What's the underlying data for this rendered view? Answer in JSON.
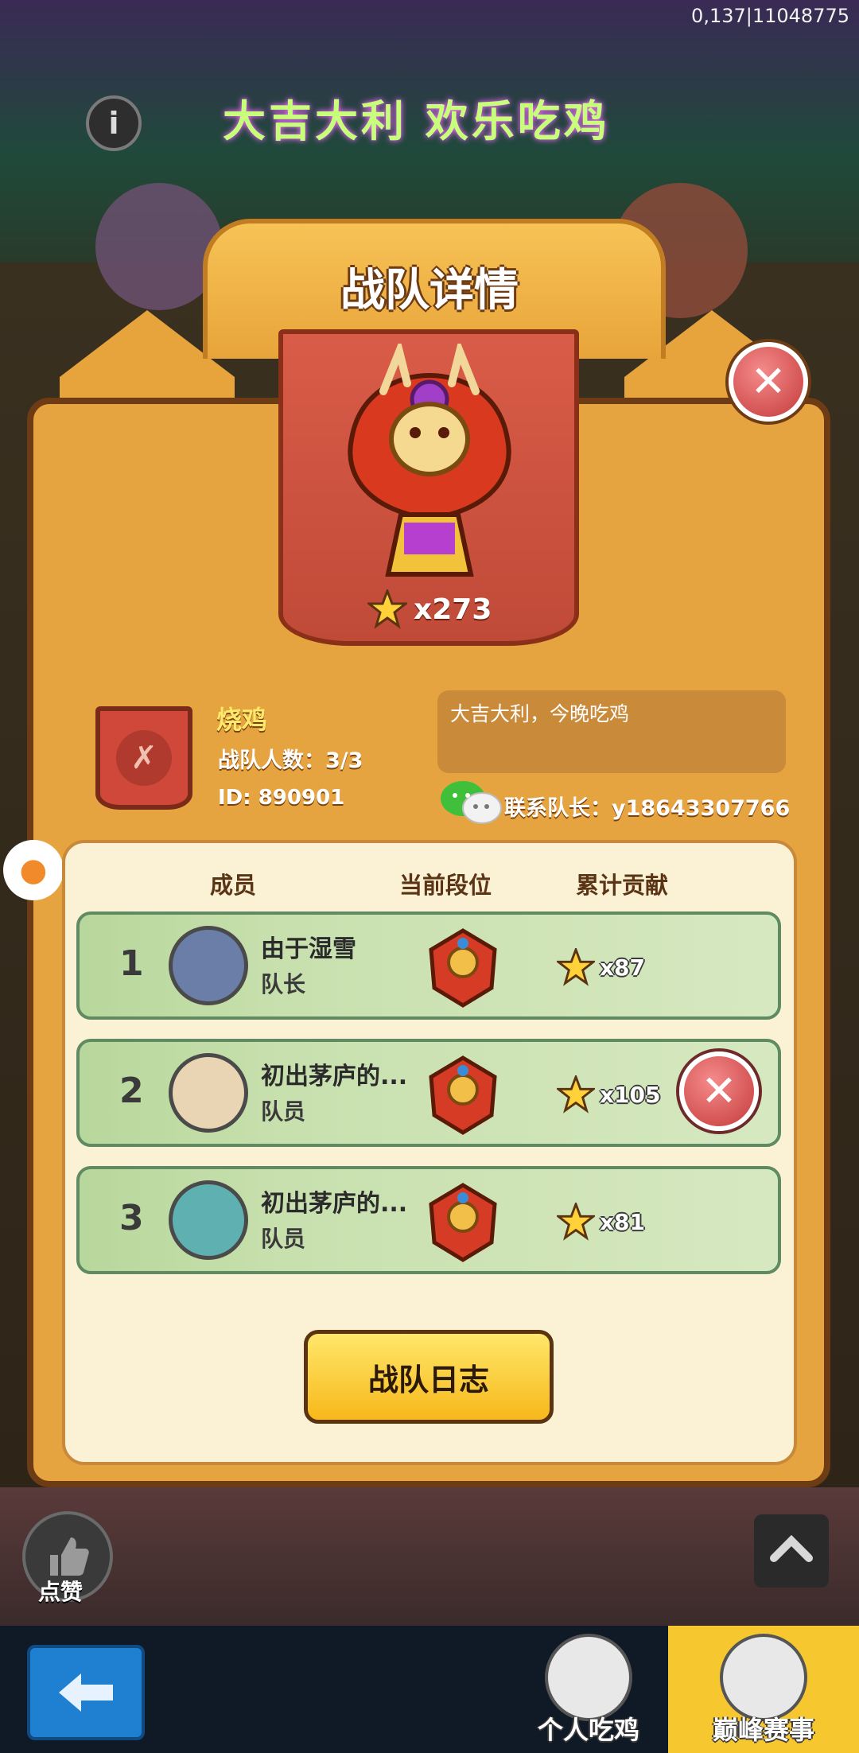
{
  "overlay_id": "0,137|11048775",
  "event_banner": "大吉大利 欢乐吃鸡",
  "info_icon": "i",
  "modal": {
    "title": "战队详情",
    "score": "x273"
  },
  "team": {
    "name": "烧鸡",
    "member_count": "战队人数：3/3",
    "id": "ID: 890901",
    "slogan": "大吉大利，今晚吃鸡",
    "contact": "联系队长：y18643307766"
  },
  "table": {
    "headers": [
      "成员",
      "当前段位",
      "累计贡献"
    ],
    "rows": [
      {
        "rank": "1",
        "name": "由于湿雪",
        "role": "队长",
        "contribution": "x87",
        "avatar_color": "#6a7ea8"
      },
      {
        "rank": "2",
        "name": "初出茅庐的...",
        "role": "队员",
        "contribution": "x105",
        "avatar_color": "#e9d4b4"
      },
      {
        "rank": "3",
        "name": "初出茅庐的...",
        "role": "队员",
        "contribution": "x81",
        "avatar_color": "#5fb0b0"
      }
    ]
  },
  "log_button": "战队日志",
  "like_label": "点赞",
  "tabs": [
    "个人吃鸡",
    "巅峰赛事"
  ],
  "colors": {
    "modal_bg": "#e6a440",
    "modal_border": "#6e3c14",
    "row_bg": "#c8e0ae",
    "close_red": "#c53a3a",
    "button_yellow": "#f7b81a"
  }
}
